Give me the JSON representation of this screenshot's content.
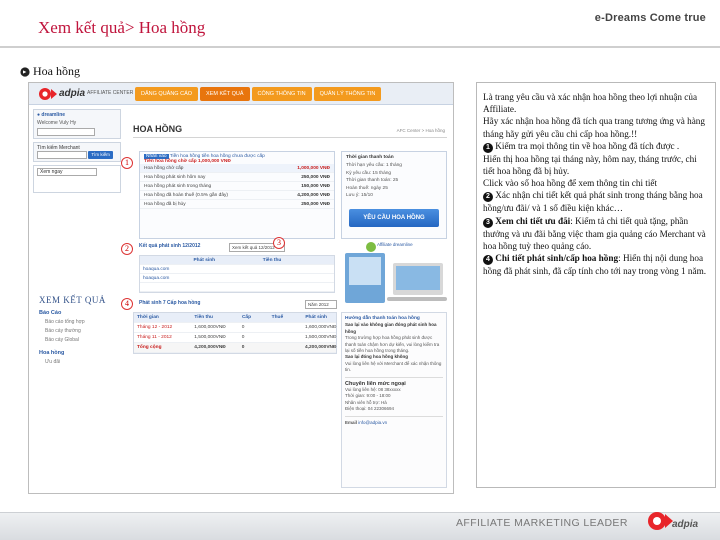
{
  "slide": {
    "title": "Xem kết quả> Hoa hồng",
    "brand": "e-Dreams Come true",
    "section": "Hoa hồng",
    "footer_text": "AFFILIATE MARKETING LEADER",
    "footer_brand": "adpia"
  },
  "app": {
    "logo_text": "adpia",
    "center_label": "AFFILIATE CENTER",
    "menu": [
      "DĂNG QUẢNG CÁO",
      "XEM KẾT QUẢ",
      "CÔNG THÔNG TIN",
      "QUẢN LÝ THÔNG TIN"
    ],
    "left": {
      "user": "dreamline",
      "welcome": "Welcome Vuly Hy",
      "merchant_label": "Tìm kiếm Merchant",
      "search_button": "Tìm kiếm",
      "xem_select": "Xem ngay",
      "section_title": "XEM KẾT QUẢ",
      "groups": [
        {
          "label": "Báo Cáo",
          "items": [
            "Báo cáo tổng hợp",
            "Báo cáy thường",
            "Báo cáy Global"
          ]
        },
        {
          "label": "Hoa hồng",
          "items": [
            "Ưu đãi"
          ]
        }
      ]
    },
    "content": {
      "title": "HOA HỒNG",
      "breadcrumb": "AFC Center > Hoa hồng",
      "info_head_link": "Nhấn vào",
      "info_head_text": "Tiền hoa hồng tiền hoa hồng chưa được cấp",
      "info_head_sub": "Tiền hoa hồng chờ cấp",
      "info_head_value": "1,000,000 VNĐ",
      "rows": [
        {
          "label": "Hoa hồng chờ cấp",
          "value": "1,000,000 VNĐ",
          "total": true
        },
        {
          "label": "Hoa hồng phát sinh hôm nay",
          "value": "250,000 VNĐ",
          "total": false
        },
        {
          "label": "Hoa hồng phát sinh trong tháng",
          "value": "150,000 VNĐ",
          "total": false
        },
        {
          "label": "Hoa hồng đã hoàn thuế (0.5% gần đây)",
          "value": "4,200,000 VNĐ",
          "total": false
        },
        {
          "label": "Hoa hồng đã bị hủy",
          "value": "250,000 VNĐ",
          "total": false
        }
      ],
      "period": {
        "heading": "Thời gian thanh toán",
        "lines": [
          "Thời hạn yêu cầu: 1 tháng",
          "Kỳ yêu cầu: 15 tháng",
          "Thời gian thanh toán: 25",
          "Hoàn thuế: ngày 25",
          "Lưu ý: 15/10"
        ]
      },
      "request_button": "YÊU CẦU HOA HỒNG",
      "t2": {
        "heading": "Kết quả phát sinh 12/2012",
        "select": "Xem kết quả 12/2012",
        "columns": [
          "",
          "Phát sinh",
          "Tiền thu"
        ],
        "rows": [
          [
            "hoaqua.com",
            "",
            ""
          ],
          [
            "hoaqua.com",
            "",
            ""
          ],
          [
            "",
            "",
            ""
          ]
        ]
      },
      "ad_label": "Affiliate dreamline",
      "t3": {
        "heading": "Phát sinh 7 Cấp hoa hồng",
        "select": "Năm 2012",
        "columns": [
          "Thời gian",
          "Tiền thu",
          "Cấp",
          "Thuế",
          "Phát sinh"
        ],
        "rows": [
          [
            "Tháng 12 - 2012",
            "1,600,000VNĐ",
            "0",
            "",
            "1,600,000VNĐ"
          ],
          [
            "Tháng 11 - 2012",
            "1,500,000VNĐ",
            "0",
            "",
            "1,500,000VNĐ"
          ],
          [
            "Tổng cộng",
            "4,200,000VNĐ",
            "0",
            "",
            "4,200,000VNĐ"
          ]
        ]
      },
      "help": {
        "heading": "Hướng dẫn thanh toán hoa hồng",
        "q1": "Sao lại vào không gian đóng phát sinh hoa hồng",
        "a1": "Trong trường hợp hoa hồng phát sinh được thanh toán chậm hơn dự kiến, vui lòng kiểm tra lại số tiền hoa hồng trong tháng.",
        "q2": "Sao lại đóng hoa hồng không",
        "a2": "Vui lòng liên hệ với Merchant để xác nhận thông tin.",
        "big": "Chuyên liên mức ngoại",
        "contact": [
          "Vui lòng liên hệ: 08 38xxxxx",
          "Thời gian: 9:00 - 18:00",
          "Nhân viên hỗ trợ: Hà",
          "Điện thoại: 04 22306694"
        ],
        "email_label": "Email",
        "email": "info@adpia.vn"
      }
    }
  },
  "badges": [
    "1",
    "2",
    "3",
    "4"
  ],
  "description": {
    "intro": "Là trang yêu cầu và xác nhận hoa hồng theo lợi nhuận của Affiliate.",
    "intro2": "Hãy xác nhận hoa hồng đã tích qua trang tương ứng và hàng tháng hãy gửi yêu cầu chi cấp hoa hồng.!!",
    "p1": "Kiểm tra mọi thông tin về hoa hồng đã tích được .",
    "p1b": "Hiển thị hoa hồng tại tháng này, hôm nay, tháng trước, chi tiết hoa hồng đã bị hủy.",
    "p1c": "Click vào số hoa hồng để xem thông tin chi tiết",
    "p2": "Xác nhận chi tiết kết quả phát sinh trong tháng bằng hoa hồng/ưu đãi/ và 1 số điều kiện khác…",
    "p3_bold": "Xem chi tiết ưu đãi",
    "p3": ": Kiểm tả chi tiết quà tặng, phần thưởng và ưu đãi bằng việc tham gia quảng cáo Merchant và hoa hồng tuỳ theo quảng cáo.",
    "p4_bold": "Chi tiết phát sinh/cấp hoa hồng",
    "p4": ": Hiển thị nội dung hoa hồng đã phát sinh, đã cấp tính cho tới nay trong vòng 1 năm."
  },
  "colors": {
    "accent": "#c0143c",
    "menu": "#f39a1e",
    "link": "#2b5aa3",
    "badge": "#dd2222"
  }
}
